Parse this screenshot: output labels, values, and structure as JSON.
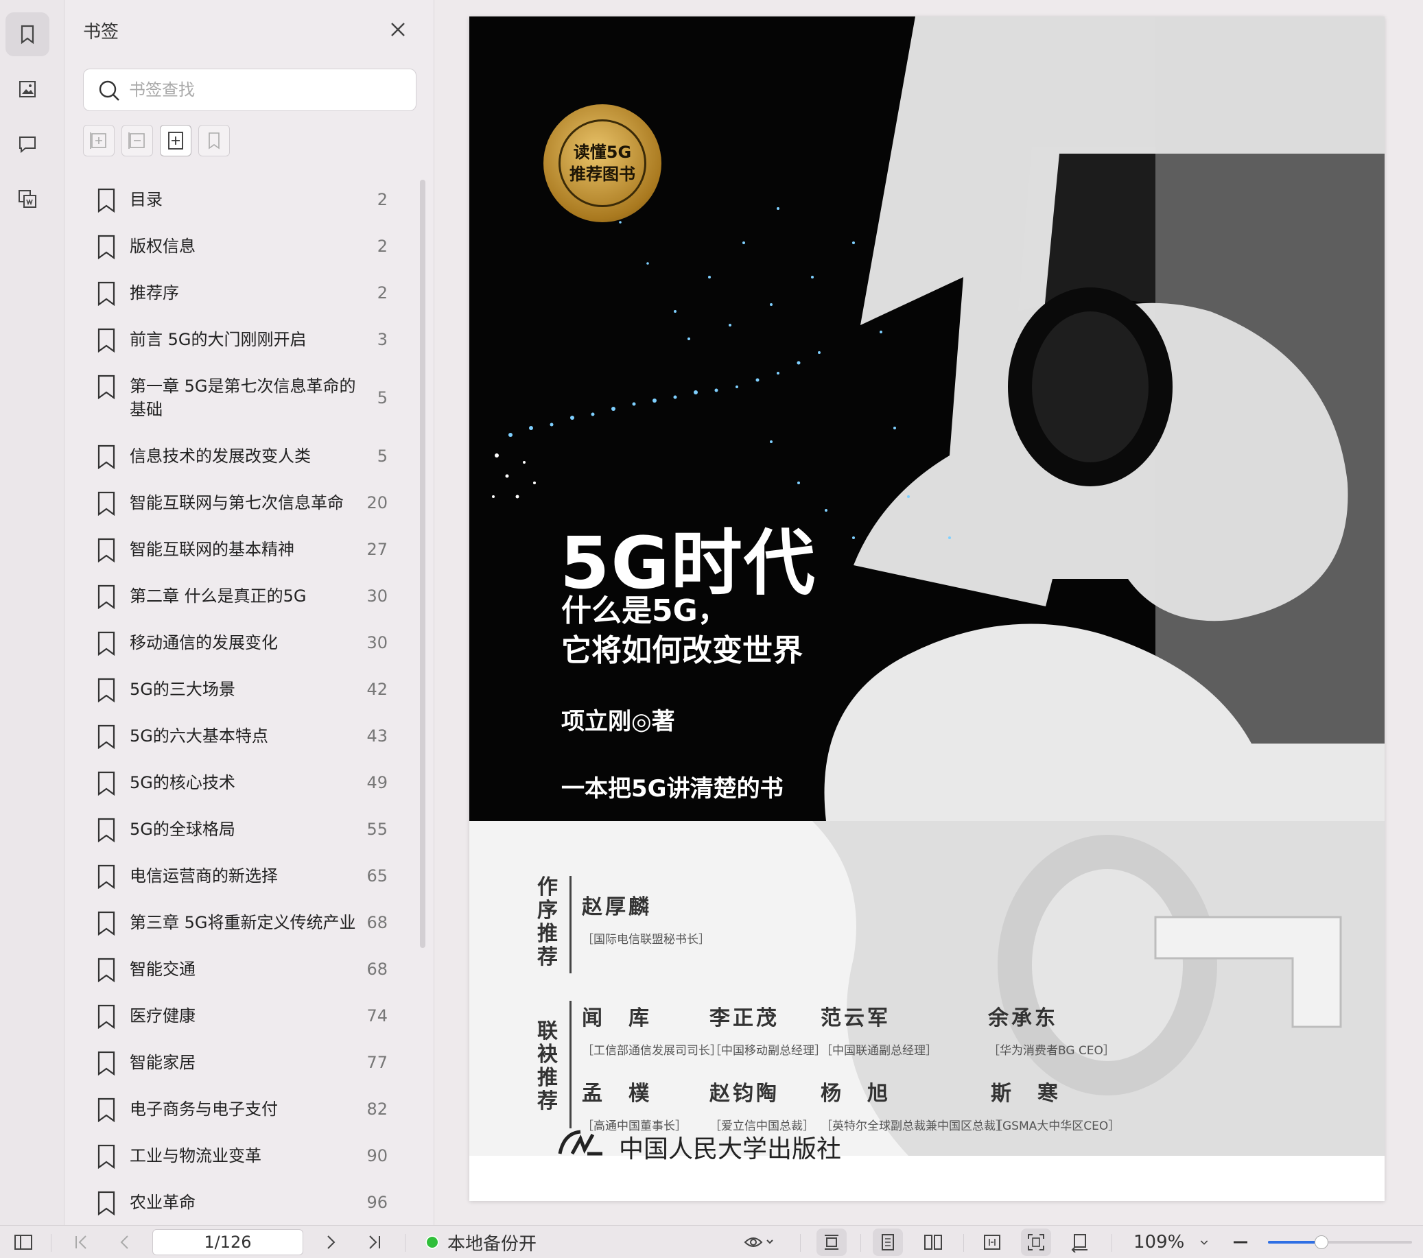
{
  "panel": {
    "title": "书签",
    "search_placeholder": "书签查找"
  },
  "bookmarks": [
    {
      "label": "目录",
      "page": "2"
    },
    {
      "label": "版权信息",
      "page": "2"
    },
    {
      "label": "推荐序",
      "page": "2"
    },
    {
      "label": "前言 5G的大门刚刚开启",
      "page": "3"
    },
    {
      "label": "第一章 5G是第七次信息革命的基础",
      "page": "5"
    },
    {
      "label": "信息技术的发展改变人类",
      "page": "5"
    },
    {
      "label": "智能互联网与第七次信息革命",
      "page": "20"
    },
    {
      "label": "智能互联网的基本精神",
      "page": "27"
    },
    {
      "label": "第二章 什么是真正的5G",
      "page": "30"
    },
    {
      "label": "移动通信的发展变化",
      "page": "30"
    },
    {
      "label": "5G的三大场景",
      "page": "42"
    },
    {
      "label": "5G的六大基本特点",
      "page": "43"
    },
    {
      "label": "5G的核心技术",
      "page": "49"
    },
    {
      "label": "5G的全球格局",
      "page": "55"
    },
    {
      "label": "电信运营商的新选择",
      "page": "65"
    },
    {
      "label": "第三章 5G将重新定义传统产业",
      "page": "68"
    },
    {
      "label": "智能交通",
      "page": "68"
    },
    {
      "label": "医疗健康",
      "page": "74"
    },
    {
      "label": "智能家居",
      "page": "77"
    },
    {
      "label": "电子商务与电子支付",
      "page": "82"
    },
    {
      "label": "工业与物流业变革",
      "page": "90"
    },
    {
      "label": "农业革命",
      "page": "96"
    }
  ],
  "cover": {
    "seal_line1": "读懂5G",
    "seal_line2": "推荐图书",
    "title": "5G时代",
    "subtitle_line1": "什么是5G，",
    "subtitle_line2": "它将如何改变世界",
    "author": "项立刚◎著",
    "slogan": "一本把5G讲清楚的书",
    "preface_label": "作序推荐",
    "joint_label": "联袂推荐",
    "preface": {
      "name": "赵厚麟",
      "title": "［国际电信联盟秘书长］"
    },
    "joint": [
      {
        "name": "闻　库",
        "title": "［工信部通信发展司司长］"
      },
      {
        "name": "李正茂",
        "title": "［中国移动副总经理］"
      },
      {
        "name": "范云军",
        "title": "［中国联通副总经理］"
      },
      {
        "name": "余承东",
        "title": "［华为消费者BG CEO］"
      },
      {
        "name": "孟　樸",
        "title": "［高通中国董事长］"
      },
      {
        "name": "赵钧陶",
        "title": "［爱立信中国总裁］"
      },
      {
        "name": "杨　旭",
        "title": "［英特尔全球副总裁兼中国区总裁］"
      },
      {
        "name": "斯　寒",
        "title": "［GSMA大中华区CEO］"
      }
    ],
    "publisher": "中国人民大学出版社"
  },
  "statusbar": {
    "page_indicator": "1/126",
    "backup_label": "本地备份开",
    "zoom": "109%",
    "zoom_level": 0.37
  }
}
